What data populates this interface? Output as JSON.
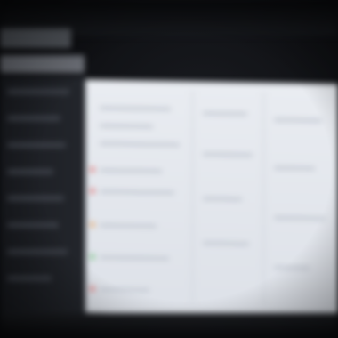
{
  "window": {
    "title": ""
  },
  "colors": {
    "bezel": "#0d0e11",
    "sidebar": "#1f2226",
    "content_bg": "#e6e9ee",
    "accent_red": "#e06a6a",
    "accent_orange": "#e8a25c",
    "accent_green": "#6ec07a"
  },
  "sidebar": {
    "items": [
      {
        "label": ""
      },
      {
        "label": ""
      },
      {
        "label": ""
      },
      {
        "label": ""
      },
      {
        "label": ""
      },
      {
        "label": ""
      },
      {
        "label": ""
      },
      {
        "label": ""
      }
    ]
  },
  "content": {
    "columns": [
      "",
      "",
      ""
    ],
    "row_markers": [
      "accent_red",
      "accent_red",
      "accent_orange",
      "accent_green",
      "accent_red"
    ]
  }
}
